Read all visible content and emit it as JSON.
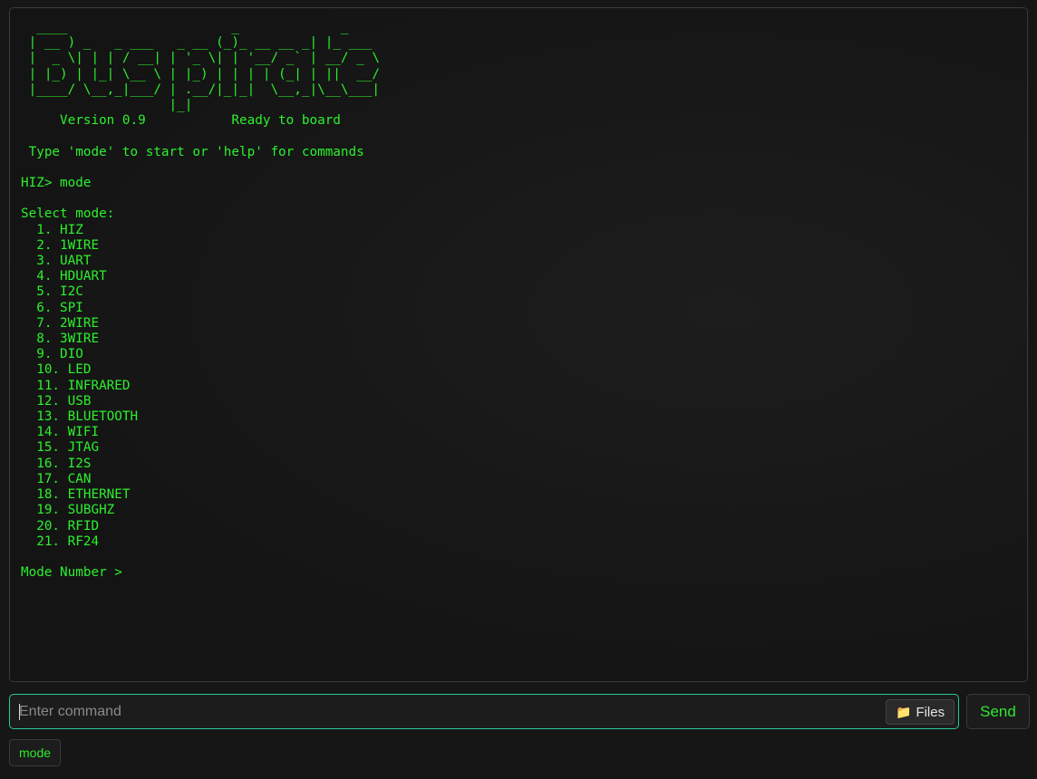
{
  "terminal": {
    "lines": [
      "  ____                     _             _",
      " | __ ) _   _ ___   _ __ (_)_ __ __ _| |_ ___",
      " |  _ \\| | | / __| | '_ \\| | '__/ _` | __/ _ \\",
      " | |_) | |_| \\__ \\ | |_) | | | | (_| | ||  __/",
      " |____/ \\__,_|___/ | .__/|_|_|  \\__,_|\\__\\___|",
      "                   |_|",
      "     Version 0.9           Ready to board",
      "",
      " Type 'mode' to start or 'help' for commands",
      "",
      "HIZ> mode",
      "",
      "Select mode:",
      "  1. HIZ",
      "  2. 1WIRE",
      "  3. UART",
      "  4. HDUART",
      "  5. I2C",
      "  6. SPI",
      "  7. 2WIRE",
      "  8. 3WIRE",
      "  9. DIO",
      "  10. LED",
      "  11. INFRARED",
      "  12. USB",
      "  13. BLUETOOTH",
      "  14. WIFI",
      "  15. JTAG",
      "  16. I2S",
      "  17. CAN",
      "  18. ETHERNET",
      "  19. SUBGHZ",
      "  20. RFID",
      "  21. RF24",
      "",
      "Mode Number >"
    ]
  },
  "command": {
    "placeholder": "Enter command",
    "value": ""
  },
  "files_button": {
    "icon": "folder-icon",
    "glyph": "📁",
    "label": "Files"
  },
  "send_button": {
    "label": "Send"
  },
  "history": [
    "mode"
  ],
  "colors": {
    "terminal_text": "#2cf02c",
    "input_border": "#27c79a",
    "background": "#161616"
  }
}
